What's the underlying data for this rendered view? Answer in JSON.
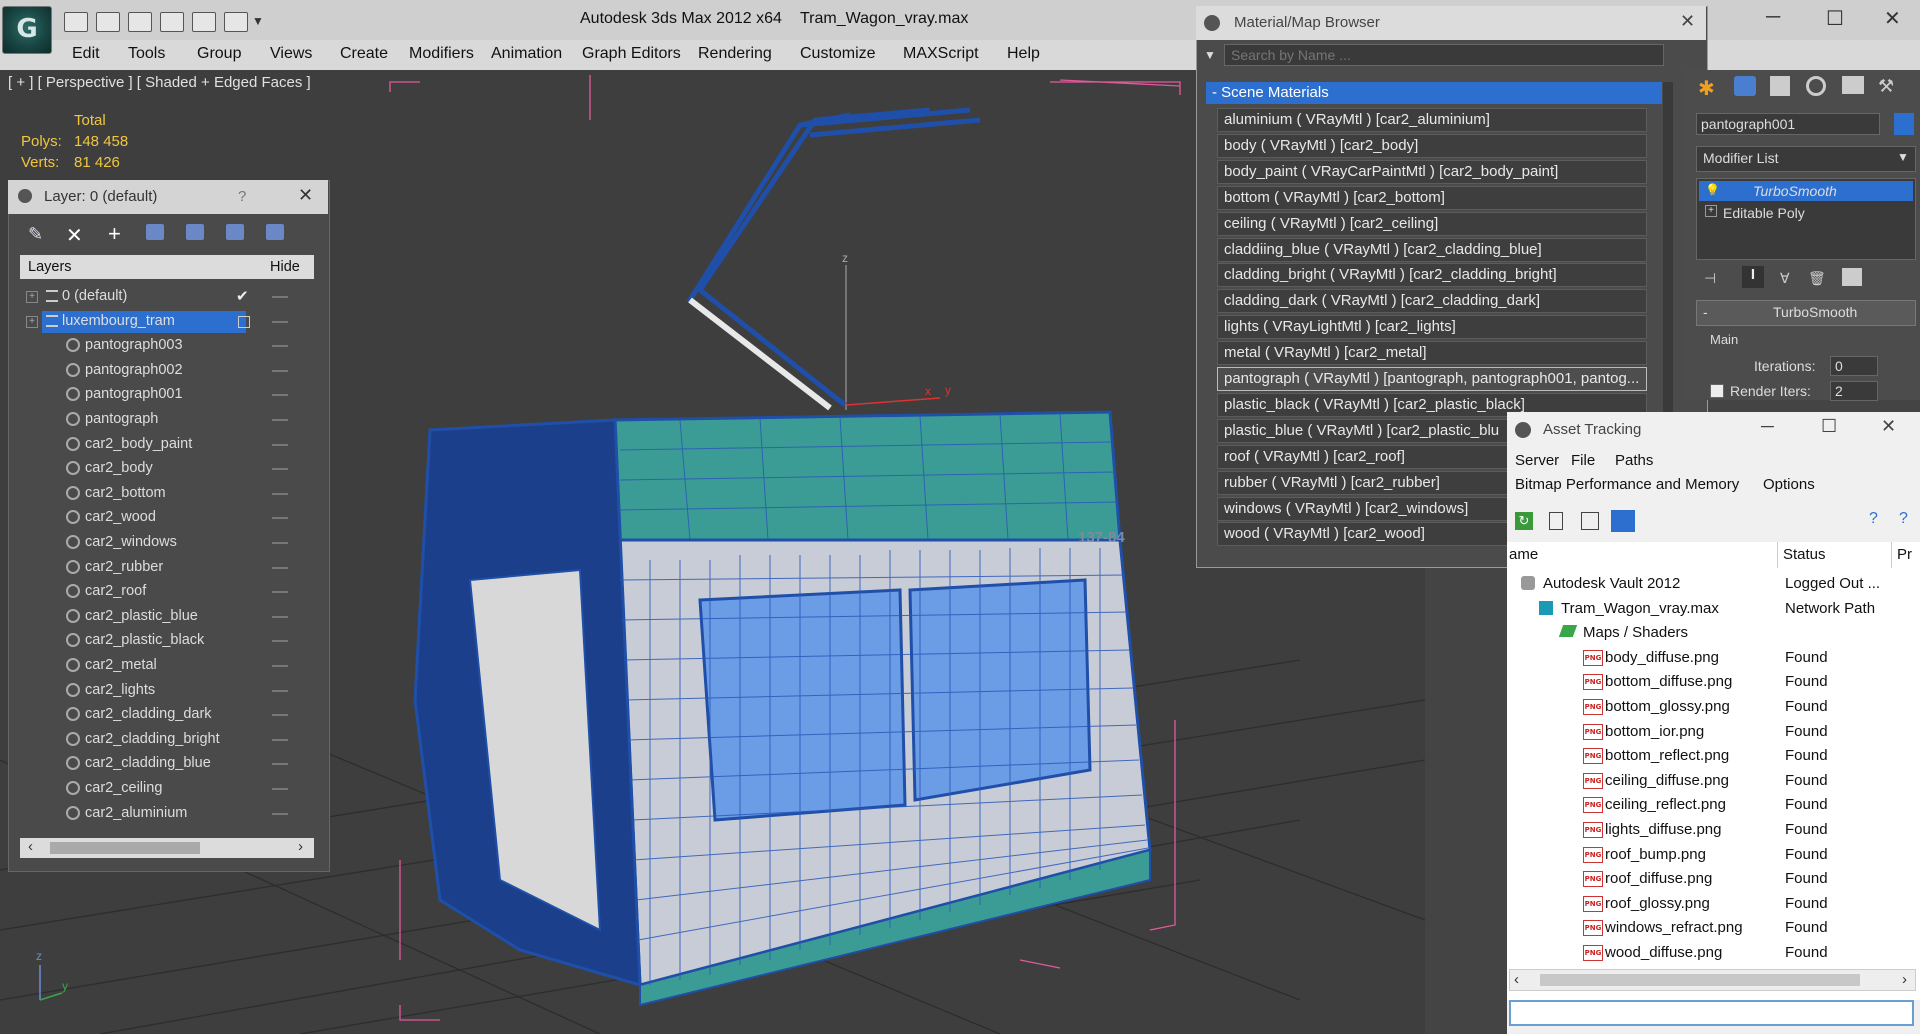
{
  "app": {
    "title": "Autodesk 3ds Max  2012 x64",
    "file": "Tram_Wagon_vray.max",
    "logo_glyph": "G"
  },
  "menu": [
    "Edit",
    "Tools",
    "Group",
    "Views",
    "Create",
    "Modifiers",
    "Animation",
    "Graph Editors",
    "Rendering",
    "Customize",
    "MAXScript",
    "Help"
  ],
  "viewport": {
    "label": "[ + ] [ Perspective ] [ Shaded + Edged Faces ]",
    "stats": {
      "total_label": "Total",
      "polys_label": "Polys:",
      "polys": "148 458",
      "verts_label": "Verts:",
      "verts": "81 426"
    },
    "decal": "137-84",
    "axis_x": "x",
    "axis_y": "y",
    "axis_z": "z"
  },
  "layer_panel": {
    "title": "Layer: 0 (default)",
    "help": "?",
    "col_layers": "Layers",
    "col_hide": "Hide",
    "rows": [
      {
        "name": "0 (default)",
        "level": 0
      },
      {
        "name": "luxembourg_tram",
        "level": 0
      },
      {
        "name": "pantograph003",
        "level": 1
      },
      {
        "name": "pantograph002",
        "level": 1
      },
      {
        "name": "pantograph001",
        "level": 1
      },
      {
        "name": "pantograph",
        "level": 1
      },
      {
        "name": "car2_body_paint",
        "level": 1
      },
      {
        "name": "car2_body",
        "level": 1
      },
      {
        "name": "car2_bottom",
        "level": 1
      },
      {
        "name": "car2_wood",
        "level": 1
      },
      {
        "name": "car2_windows",
        "level": 1
      },
      {
        "name": "car2_rubber",
        "level": 1
      },
      {
        "name": "car2_roof",
        "level": 1
      },
      {
        "name": "car2_plastic_blue",
        "level": 1
      },
      {
        "name": "car2_plastic_black",
        "level": 1
      },
      {
        "name": "car2_metal",
        "level": 1
      },
      {
        "name": "car2_lights",
        "level": 1
      },
      {
        "name": "car2_cladding_dark",
        "level": 1
      },
      {
        "name": "car2_cladding_bright",
        "level": 1
      },
      {
        "name": "car2_cladding_blue",
        "level": 1
      },
      {
        "name": "car2_ceiling",
        "level": 1
      },
      {
        "name": "car2_aluminium",
        "level": 1
      }
    ]
  },
  "material_browser": {
    "title": "Material/Map Browser",
    "search_placeholder": "Search by Name ...",
    "section": "- Scene Materials",
    "materials": [
      "aluminium  ( VRayMtl ) [car2_aluminium]",
      "body  ( VRayMtl ) [car2_body]",
      "body_paint  ( VRayCarPaintMtl ) [car2_body_paint]",
      "bottom  ( VRayMtl ) [car2_bottom]",
      "ceiling  ( VRayMtl ) [car2_ceiling]",
      "claddiing_blue  ( VRayMtl ) [car2_cladding_blue]",
      "cladding_bright  ( VRayMtl ) [car2_cladding_bright]",
      "cladding_dark  ( VRayMtl ) [car2_cladding_dark]",
      "lights  ( VRayLightMtl ) [car2_lights]",
      "metal  ( VRayMtl ) [car2_metal]",
      "pantograph  ( VRayMtl ) [pantograph, pantograph001, pantog...",
      "plastic_black  ( VRayMtl ) [car2_plastic_black]",
      "plastic_blue  ( VRayMtl ) [car2_plastic_blu",
      "roof  ( VRayMtl ) [car2_roof]",
      "rubber  ( VRayMtl ) [car2_rubber]",
      "windows  ( VRayMtl ) [car2_windows]",
      "wood  ( VRayMtl ) [car2_wood]"
    ]
  },
  "command_panel": {
    "object_name": "pantograph001",
    "modifier_list": "Modifier List",
    "stack": [
      "TurboSmooth",
      "Editable Poly"
    ],
    "rollout_title": "TurboSmooth",
    "group_main": "Main",
    "iterations_label": "Iterations:",
    "iterations": "0",
    "render_iters_label": "Render Iters:",
    "render_iters": "2"
  },
  "asset_tracking": {
    "title": "Asset Tracking",
    "menu": [
      "Server",
      "File",
      "Paths"
    ],
    "menu2": [
      "Bitmap Performance and Memory",
      "Options"
    ],
    "col_name": "ame",
    "col_status": "Status",
    "col_extra": "Pr",
    "rows": [
      {
        "name": "Autodesk Vault 2012",
        "status": "Logged Out ...",
        "indent": 0,
        "icon": "vault"
      },
      {
        "name": "Tram_Wagon_vray.max",
        "status": "Network Path",
        "indent": 1,
        "icon": "max"
      },
      {
        "name": "Maps / Shaders",
        "status": "",
        "indent": 2,
        "icon": "maps"
      },
      {
        "name": "body_diffuse.png",
        "status": "Found",
        "indent": 3,
        "icon": "png"
      },
      {
        "name": "bottom_diffuse.png",
        "status": "Found",
        "indent": 3,
        "icon": "png"
      },
      {
        "name": "bottom_glossy.png",
        "status": "Found",
        "indent": 3,
        "icon": "png"
      },
      {
        "name": "bottom_ior.png",
        "status": "Found",
        "indent": 3,
        "icon": "png"
      },
      {
        "name": "bottom_reflect.png",
        "status": "Found",
        "indent": 3,
        "icon": "png"
      },
      {
        "name": "ceiling_diffuse.png",
        "status": "Found",
        "indent": 3,
        "icon": "png"
      },
      {
        "name": "ceiling_reflect.png",
        "status": "Found",
        "indent": 3,
        "icon": "png"
      },
      {
        "name": "lights_diffuse.png",
        "status": "Found",
        "indent": 3,
        "icon": "png"
      },
      {
        "name": "roof_bump.png",
        "status": "Found",
        "indent": 3,
        "icon": "png"
      },
      {
        "name": "roof_diffuse.png",
        "status": "Found",
        "indent": 3,
        "icon": "png"
      },
      {
        "name": "roof_glossy.png",
        "status": "Found",
        "indent": 3,
        "icon": "png"
      },
      {
        "name": "windows_refract.png",
        "status": "Found",
        "indent": 3,
        "icon": "png"
      },
      {
        "name": "wood_diffuse.png",
        "status": "Found",
        "indent": 3,
        "icon": "png"
      }
    ],
    "png_icon_text": "PNG"
  },
  "colors": {
    "selection_blue": "#2d6fcf",
    "wire_blue": "#1f4fa8",
    "roof_teal": "#3b9c95",
    "stat_yellow": "#f0c640",
    "bbox_pink": "#e05a9a"
  }
}
